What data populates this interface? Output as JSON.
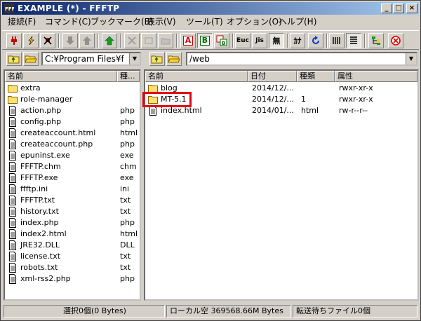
{
  "window": {
    "title": "EXAMPLE (*) - FFFTP",
    "minimize": "_",
    "maximize": "□",
    "close": "×"
  },
  "menu": [
    "接続(F)",
    "コマンド(C)",
    "ブックマーク(B)",
    "表示(V)",
    "ツール(T)",
    "オプション(O)",
    "ヘルプ(H)"
  ],
  "toolbar": {
    "ascii_mode": "A",
    "binary_mode": "B",
    "euc_mode": "Euc",
    "jis_mode": "Jis",
    "no_convert": "無",
    "kana_convert": "ｶﾅ"
  },
  "local": {
    "path": "C:¥Program Files¥f",
    "columns": [
      "名前",
      "種..."
    ],
    "files": [
      {
        "name": "extra",
        "type": "",
        "icon": "folder-icon"
      },
      {
        "name": "role-manager",
        "type": "",
        "icon": "folder-icon"
      },
      {
        "name": "action.php",
        "type": "php",
        "icon": "file-icon"
      },
      {
        "name": "config.php",
        "type": "php",
        "icon": "file-icon"
      },
      {
        "name": "createaccount.html",
        "type": "html",
        "icon": "file-icon"
      },
      {
        "name": "createaccount.php",
        "type": "php",
        "icon": "file-icon"
      },
      {
        "name": "epuninst.exe",
        "type": "exe",
        "icon": "file-icon"
      },
      {
        "name": "FFFTP.chm",
        "type": "chm",
        "icon": "file-icon"
      },
      {
        "name": "FFFTP.exe",
        "type": "exe",
        "icon": "file-icon"
      },
      {
        "name": "ffftp.ini",
        "type": "ini",
        "icon": "file-icon"
      },
      {
        "name": "FFFTP.txt",
        "type": "txt",
        "icon": "file-icon"
      },
      {
        "name": "history.txt",
        "type": "txt",
        "icon": "file-icon"
      },
      {
        "name": "index.php",
        "type": "php",
        "icon": "file-icon"
      },
      {
        "name": "index2.html",
        "type": "html",
        "icon": "file-icon"
      },
      {
        "name": "JRE32.DLL",
        "type": "DLL",
        "icon": "file-icon"
      },
      {
        "name": "license.txt",
        "type": "txt",
        "icon": "file-icon"
      },
      {
        "name": "robots.txt",
        "type": "txt",
        "icon": "file-icon"
      },
      {
        "name": "xml-rss2.php",
        "type": "php",
        "icon": "file-icon"
      }
    ]
  },
  "remote": {
    "path": "/web",
    "columns": [
      "名前",
      "日付",
      "種類",
      "属性"
    ],
    "files": [
      {
        "name": "blog",
        "date": "2014/12/...",
        "type": "",
        "attr": "rwxr-xr-x",
        "icon": "folder-icon"
      },
      {
        "name": "MT-5.1",
        "date": "2014/12/...",
        "type": "1",
        "attr": "rwxr-xr-x",
        "icon": "folder-icon"
      },
      {
        "name": "index.html",
        "date": "2014/01/...",
        "type": "html",
        "attr": "rw-r--r--",
        "icon": "file-icon"
      }
    ]
  },
  "status": {
    "selected": "選択0個(0 Bytes)",
    "local_free": "ローカル空 369568.66M Bytes",
    "queue": "転送待ちファイル0個"
  },
  "colors": {
    "title_start": "#0a246a",
    "title_end": "#a6caf0",
    "highlight": "#e60012",
    "folder": "#ffe26b"
  }
}
